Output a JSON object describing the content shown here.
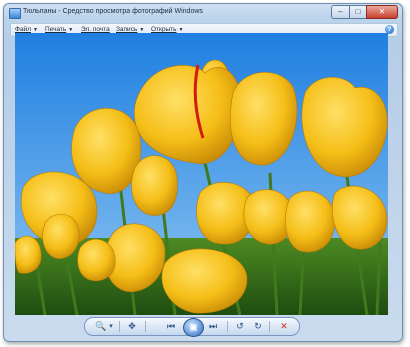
{
  "window": {
    "title": "Тюльпаны - Средство просмотра фотографий Windows",
    "minimize_glyph": "–",
    "maximize_glyph": "□",
    "close_glyph": "✕"
  },
  "menu": {
    "items": [
      {
        "label": "Файл",
        "arrow": "▼"
      },
      {
        "label": "Печать",
        "arrow": "▼"
      },
      {
        "label": "Эл. почта",
        "arrow": ""
      },
      {
        "label": "Запись",
        "arrow": "▼"
      },
      {
        "label": "Открыть",
        "arrow": "▼"
      }
    ],
    "help_glyph": "?"
  },
  "photo": {
    "subject": "tulips",
    "sky_color": "#2f8fe6",
    "petal_color": "#f6c21a",
    "stem_color": "#3f7a1c"
  },
  "toolbar": {
    "zoom_glyph": "🔍",
    "zoom_arrow": "▾",
    "fit_glyph": "✥",
    "prev_glyph": "⏮",
    "play_glyph": "▣",
    "next_glyph": "⏭",
    "rotate_left_glyph": "↺",
    "rotate_right_glyph": "↻",
    "delete_glyph": "✕"
  }
}
